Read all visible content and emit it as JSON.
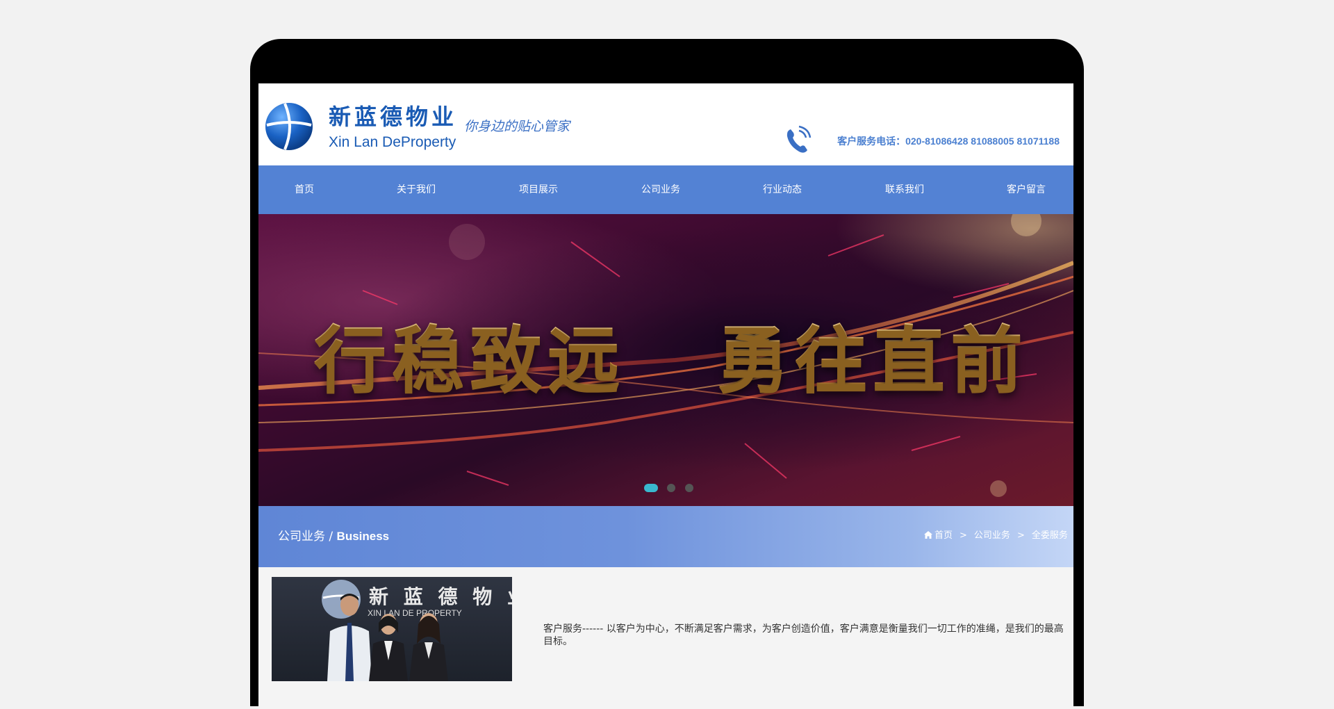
{
  "header": {
    "logo_cn": "新蓝德物业",
    "logo_en": "Xin Lan DeProperty",
    "slogan": "你身边的贴心管家",
    "hotline": "客户服务电话：020-81086428   81088005   81071188"
  },
  "nav": {
    "items": [
      {
        "label": "首页"
      },
      {
        "label": "关于我们"
      },
      {
        "label": "项目展示"
      },
      {
        "label": "公司业务"
      },
      {
        "label": "行业动态"
      },
      {
        "label": "联系我们"
      },
      {
        "label": "客户留言"
      }
    ]
  },
  "banner": {
    "text_left": "行稳致远",
    "text_right": "勇往直前",
    "slides": 3,
    "active_slide": 1
  },
  "section": {
    "title_cn": "公司业务",
    "separator": " / ",
    "title_en": "Business",
    "breadcrumb": [
      "首页",
      "公司业务",
      "全委服务"
    ],
    "breadcrumb_sep": ">"
  },
  "content": {
    "photo_sign_cn": "新 蓝 德 物 业",
    "photo_sign_en": "XIN LAN DE PROPERTY",
    "description": "客户服务------ 以客户为中心，不断满足客户需求，为客户创造价值，客户满意是衡量我们一切工作的准绳，是我们的最高目标。"
  },
  "colors": {
    "nav_bg": "#5382d4",
    "brand_blue": "#1a5bb4",
    "dot_active": "#39b8cf"
  },
  "icons": [
    "globe-logo-icon",
    "phone-icon",
    "home-icon"
  ]
}
